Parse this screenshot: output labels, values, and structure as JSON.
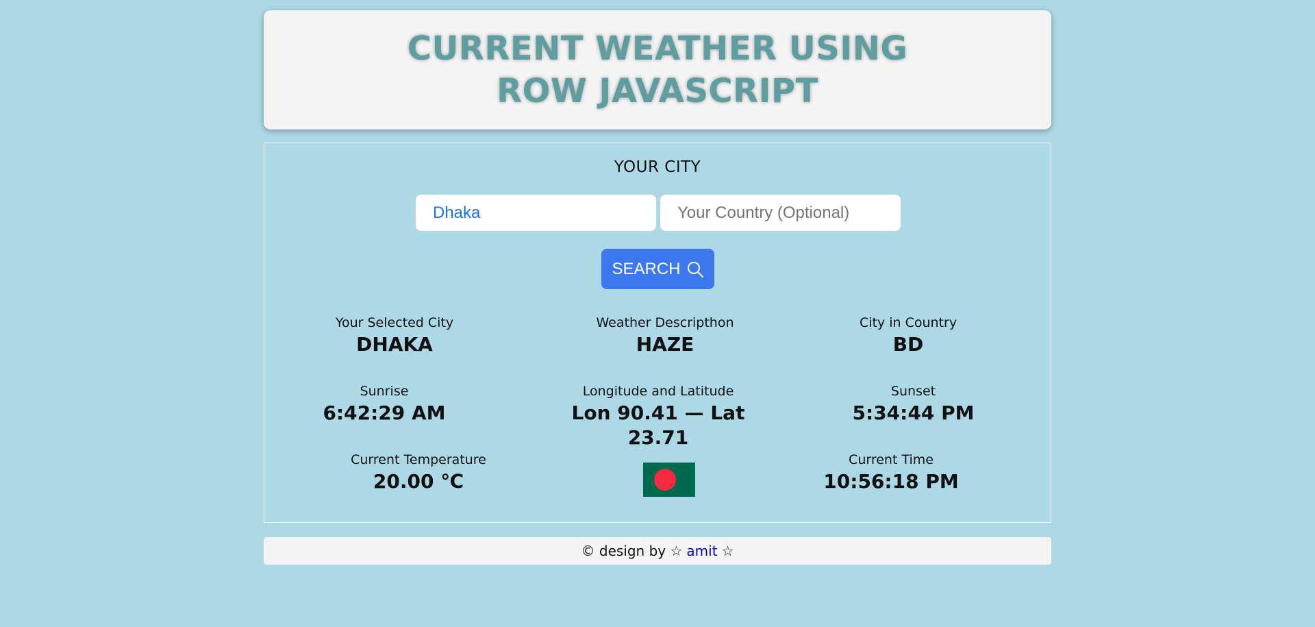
{
  "header": {
    "title": "CURRENT WEATHER USING ROW JAVASCRIPT"
  },
  "search": {
    "heading": "YOUR CITY",
    "city_value": "Dhaka",
    "country_placeholder": "Your Country (Optional)",
    "button_label": "SEARCH",
    "button_icon": "search-icon"
  },
  "weather": {
    "selected_city": {
      "label": "Your Selected City",
      "value": "DHAKA"
    },
    "description": {
      "label": "Weather Descripthon",
      "value": "HAZE"
    },
    "country": {
      "label": "City in Country",
      "value": "BD"
    },
    "sunrise": {
      "label": "Sunrise",
      "value": "6:42:29 AM"
    },
    "coordinates": {
      "label": "Longitude and Latitude",
      "value": "Lon 90.41 — Lat 23.71"
    },
    "sunset": {
      "label": "Sunset",
      "value": "5:34:44 PM"
    },
    "temperature": {
      "label": "Current Temperature",
      "value": "20.00 ℃"
    },
    "current_time": {
      "label": "Current Time",
      "value": "10:56:18 PM"
    },
    "flag_icon": "bangladesh-flag-icon"
  },
  "footer": {
    "prefix": "© design by ☆",
    "author_link": "amit",
    "suffix": "☆"
  },
  "colors": {
    "background": "#add8e6",
    "title": "#5f9ea0",
    "button": "#3b78f0",
    "link": "#0000ee"
  }
}
